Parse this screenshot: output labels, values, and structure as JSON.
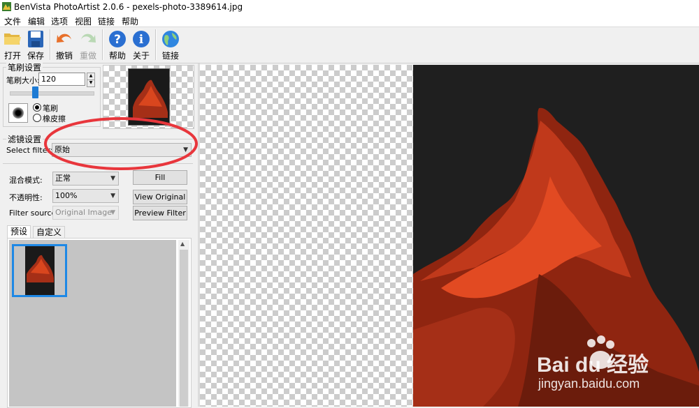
{
  "window": {
    "title": "BenVista PhotoArtist 2.0.6 - pexels-photo-3389614.jpg"
  },
  "menu": [
    "文件",
    "编辑",
    "选项",
    "视图",
    "链接",
    "帮助"
  ],
  "toolbar": {
    "open": "打开",
    "save": "保存",
    "undo": "撤销",
    "redo": "重做",
    "help": "帮助",
    "about": "关于",
    "link": "链接"
  },
  "brush": {
    "group_title": "笔刷设置",
    "size_label": "笔刷大小:",
    "size_value": "120",
    "slider_fraction": 0.3,
    "mode_brush": "笔刷",
    "mode_eraser": "橡皮擦",
    "selected_mode": "笔刷"
  },
  "filter": {
    "group_title": "滤镜设置",
    "select_label": "Select filter:",
    "selected": "原始"
  },
  "blend": {
    "mode_label": "混合模式:",
    "mode_value": "正常",
    "opacity_label": "不透明性:",
    "opacity_value": "100%",
    "source_label": "Filter source:",
    "source_value": "Original Image"
  },
  "buttons": {
    "fill": "Fill",
    "view_original": "View Original",
    "preview_filter": "Preview Filter"
  },
  "tabs": {
    "presets": "预设",
    "custom": "自定义",
    "active": "预设"
  },
  "watermark": {
    "brand": "Bai du 经验",
    "url": "jingyan.baidu.com"
  },
  "colors": {
    "highlight_circle": "#e8363c",
    "selection_blue": "#1e88e5",
    "canvas_dark": "#1f1f1f",
    "rock_red": "#c0391b"
  }
}
